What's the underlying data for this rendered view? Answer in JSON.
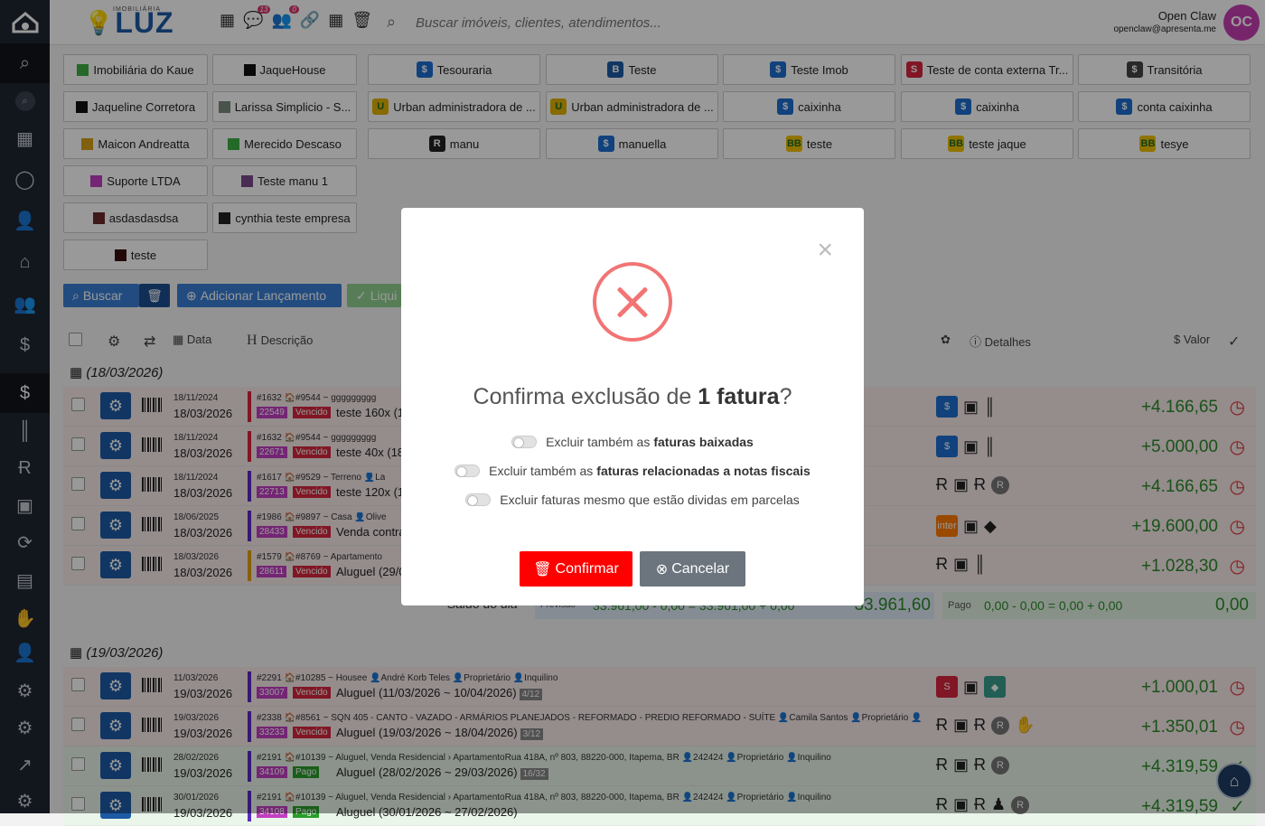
{
  "header": {
    "logo_text": "LUZ",
    "logo_sub": "IMOBILIÁRIA",
    "badge_chat": "13",
    "badge_users": "0",
    "search_placeholder": "Buscar imóveis, clientes, atendimentos...",
    "user_name": "Open Claw",
    "user_email": "openclaw@apresenta.me",
    "avatar_initials": "OC"
  },
  "sidebar": {
    "icons": [
      "search-icon",
      "search-small-icon",
      "dashboard-icon",
      "whatsapp-icon",
      "user-icon",
      "home-icon",
      "people-icon",
      "money-icon",
      "dollar-icon",
      "barcode-icon",
      "r-logo-icon",
      "certificate-icon",
      "refresh-money-icon",
      "bill-icon",
      "hand-money-icon",
      "person-icon",
      "gear-icon",
      "gears-icon",
      "chart-icon",
      "settings-icon"
    ]
  },
  "companies": [
    {
      "label": "Imobiliária do Kaue",
      "color": "#3cb043"
    },
    {
      "label": "JaqueHouse",
      "color": "#111111"
    },
    {
      "label": "Jaqueline Corretora",
      "color": "#111111"
    },
    {
      "label": "Larissa Simplicio - S...",
      "color": "#7a8a7a"
    },
    {
      "label": "Maicon Andreatta",
      "color": "#d4a017"
    },
    {
      "label": "Merecido Descaso",
      "color": "#3cb043"
    },
    {
      "label": "Suporte LTDA",
      "color": "#c23fc2"
    },
    {
      "label": "Teste manu 1",
      "color": "#7b4a8a"
    },
    {
      "label": "asdasdasdsa",
      "color": "#6b2a2a"
    },
    {
      "label": "cynthia teste empresa",
      "color": "#222222"
    },
    {
      "label": "teste",
      "color": "#3a1010"
    }
  ],
  "accounts": [
    {
      "label": "Tesouraria",
      "icon": "$",
      "color": "#1d6fd1"
    },
    {
      "label": "Teste",
      "icon": "B",
      "color": "#1d5aa5"
    },
    {
      "label": "Teste Imob",
      "icon": "$",
      "color": "#1d6fd1"
    },
    {
      "label": "Teste de conta externa Tr...",
      "icon": "S",
      "color": "#d7263d"
    },
    {
      "label": "Transitória",
      "icon": "$",
      "color": "#444444"
    },
    {
      "label": "Urban administradora de ...",
      "icon": "U",
      "color": "#e1b100"
    },
    {
      "label": "Urban administradora de ...",
      "icon": "U",
      "color": "#e1b100"
    },
    {
      "label": "caixinha",
      "icon": "$",
      "color": "#1d6fd1"
    },
    {
      "label": "caixinha",
      "icon": "$",
      "color": "#1d6fd1"
    },
    {
      "label": "conta caixinha",
      "icon": "$",
      "color": "#1d6fd1"
    },
    {
      "label": "manu",
      "icon": "R",
      "color": "#222222"
    },
    {
      "label": "manuella",
      "icon": "$",
      "color": "#1d6fd1"
    },
    {
      "label": "teste",
      "icon": "BB",
      "color": "#f2c200"
    },
    {
      "label": "teste jaque",
      "icon": "BB",
      "color": "#f2c200"
    },
    {
      "label": "tesye",
      "icon": "BB",
      "color": "#f2c200"
    }
  ],
  "toolbar": {
    "search_label": "Buscar",
    "add_label": "Adicionar Lançamento",
    "liquidate_label": "Liqui"
  },
  "table_head": {
    "date": "Data",
    "description": "Descrição",
    "details": "Detalhes",
    "value": "Valor"
  },
  "groups": [
    {
      "date": "(18/03/2026)"
    },
    {
      "date": "(19/03/2026)"
    }
  ],
  "rows": [
    {
      "d1": "18/11/2024",
      "d2": "18/03/2026",
      "stripe": "#d7263d",
      "meta": "#1632 🏠#9544 ~ ggggggggg",
      "code": "22549",
      "code_color": "#c23fc2",
      "status": "Vencido",
      "status_color": "#d7263d",
      "desc": "teste 160x (1",
      "parc": "",
      "value": "+4.166,65",
      "bg": "#f9eaea"
    },
    {
      "d1": "18/11/2024",
      "d2": "18/03/2026",
      "stripe": "#d7263d",
      "meta": "#1632 🏠#9544 ~ ggggggggg",
      "code": "22671",
      "code_color": "#c23fc2",
      "status": "Vencido",
      "status_color": "#d7263d",
      "desc": "teste 40x (18",
      "parc": "",
      "value": "+5.000,00",
      "bg": "#f9eaea"
    },
    {
      "d1": "18/11/2024",
      "d2": "18/03/2026",
      "stripe": "#5b2bc1",
      "meta": "#1617 🏠#9529 ~ Terreno 👤La",
      "code": "22713",
      "code_color": "#c23fc2",
      "status": "Vencido",
      "status_color": "#d7263d",
      "desc": "teste 120x (1",
      "parc": "",
      "value": "+4.166,65",
      "bg": "#f9eaea"
    },
    {
      "d1": "18/06/2025",
      "d2": "18/03/2026",
      "stripe": "#5b2bc1",
      "meta": "#1986 🏠#9897 ~ Casa 👤Olive",
      "code": "28433",
      "code_color": "#c23fc2",
      "status": "Vencido",
      "status_color": "#d7263d",
      "desc": "Venda contra",
      "parc": "",
      "value": "+19.600,00",
      "bg": "#f9eaea"
    },
    {
      "d1": "18/03/2026",
      "d2": "18/03/2026",
      "stripe": "#e1a100",
      "meta": "#1579 🏠#8769 ~ Apartamento",
      "code": "28611",
      "code_color": "#c23fc2",
      "status": "Vencido",
      "status_color": "#d7263d",
      "desc": "Aluguel (29/0",
      "parc": "",
      "value": "+1.028,30",
      "bg": "#f9eaea"
    },
    {
      "d1": "11/03/2026",
      "d2": "19/03/2026",
      "stripe": "#5b2bc1",
      "meta": "#2291 🏠#10285 ~ Housee 👤André Korb Teles 👤Proprietário 👤Inquilino",
      "code": "33007",
      "code_color": "#c23fc2",
      "status": "Vencido",
      "status_color": "#d7263d",
      "desc": "Aluguel (11/03/2026 ~ 10/04/2026)",
      "parc": "4/12",
      "value": "+1.000,01",
      "bg": "#f9eaea"
    },
    {
      "d1": "19/03/2026",
      "d2": "19/03/2026",
      "stripe": "#5b2bc1",
      "meta": "#2338 🏠#8561 ~ SQN 405 - CANTO - VAZADO - ARMÁRIOS PLANEJADOS - REFORMADO - PREDIO REFORMADO - SUÍTE 👤Camila Santos 👤Proprietário 👤",
      "code": "33233",
      "code_color": "#c23fc2",
      "status": "Vencido",
      "status_color": "#d7263d",
      "desc": "Aluguel (19/03/2026 ~ 18/04/2026)",
      "parc": "3/12",
      "value": "+1.350,01",
      "bg": "#f9eaea"
    },
    {
      "d1": "28/02/2026",
      "d2": "19/03/2026",
      "stripe": "#5b2bc1",
      "meta": "#2191 🏠#10139 ~ Aluguel, Venda Residencial › ApartamentoRua 418A, nº 803, 88220-000, Itapema, BR 👤242424 👤Proprietário 👤Inquilino",
      "code": "34109",
      "code_color": "#c23fc2",
      "status": "Pago",
      "status_color": "#2a9d2a",
      "desc": "Aluguel (28/02/2026 ~ 29/03/2026)",
      "parc": "16/32",
      "value": "+4.319,59",
      "bg": "#eaf6ea"
    },
    {
      "d1": "30/01/2026",
      "d2": "19/03/2026",
      "stripe": "#5b2bc1",
      "meta": "#2191 🏠#10139 ~ Aluguel, Venda Residencial › ApartamentoRua 418A, nº 803, 88220-000, Itapema, BR 👤242424 👤Proprietário 👤Inquilino",
      "code": "34108",
      "code_color": "#c23fc2",
      "status": "Pago",
      "status_color": "#2a9d2a",
      "desc": "Aluguel (30/01/2026 ~ 27/02/2026)",
      "parc": "",
      "value": "+4.319,59",
      "bg": "#eaf6ea"
    }
  ],
  "summary": {
    "label": "Saldo do dia",
    "prev_label": "Previsão",
    "prev_formula": "33.961,00 - 0,00 = 33.961,00 + 0,00",
    "prev_total": "33.961,60",
    "paid_label": "Pago",
    "paid_formula": "0,00 - 0,00 = 0,00 + 0,00",
    "paid_total": "0,00"
  },
  "modal": {
    "title_pre": "Confirma exclusão de ",
    "title_bold": "1 fatura",
    "title_post": "?",
    "opt1_pre": "Excluir também as",
    "opt1_bold": "faturas baixadas",
    "opt2_pre": "Excluir também as",
    "opt2_bold": "faturas relacionadas a notas fiscais",
    "opt3": "Excluir faturas mesmo que estão dividas em parcelas",
    "confirm_label": "Confirmar",
    "cancel_label": "Cancelar",
    "close_glyph": "×"
  }
}
